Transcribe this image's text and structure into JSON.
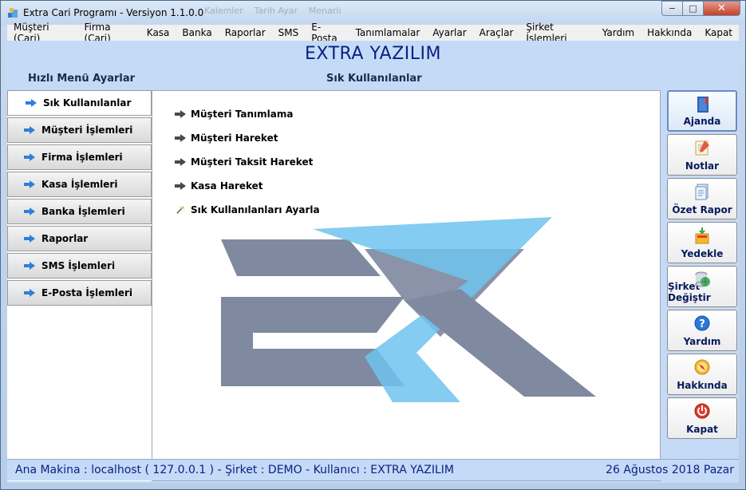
{
  "window": {
    "title": "Extra Cari Programı - Versiyon 1.1.0.0",
    "ghost_tabs": [
      "Kalemler",
      "Tarih Ayar",
      "Menarlı"
    ],
    "minimize": "−",
    "maximize": "□",
    "close": "✕"
  },
  "menu": {
    "items": [
      "Müşteri (Cari)",
      "Firma (Cari)",
      "Kasa",
      "Banka",
      "Raporlar",
      "SMS",
      "E-Posta",
      "Tanımlamalar",
      "Ayarlar",
      "Araçlar",
      "Şirket İşlemleri",
      "Yardım",
      "Hakkında",
      "Kapat"
    ]
  },
  "brand": "EXTRA YAZILIM",
  "sidebar": {
    "title": "Hızlı Menü Ayarlar",
    "items": [
      "Sık Kullanılanlar",
      "Müşteri İşlemleri",
      "Firma İşlemleri",
      "Kasa İşlemleri",
      "Banka İşlemleri",
      "Raporlar",
      "SMS İşlemleri",
      "E-Posta İşlemleri"
    ],
    "active_index": 0
  },
  "content": {
    "title": "Sık Kullanılanlar",
    "links": [
      "Müşteri Tanımlama",
      "Müşteri Hareket",
      "Müşteri Taksit Hareket",
      "Kasa Hareket"
    ],
    "settings_link": "Sık Kullanılanları Ayarla"
  },
  "right_buttons": [
    {
      "label": "Ajanda",
      "icon": "agenda-book-icon"
    },
    {
      "label": "Notlar",
      "icon": "notes-icon"
    },
    {
      "label": "Özet Rapor",
      "icon": "summary-report-icon"
    },
    {
      "label": "Yedekle",
      "icon": "backup-icon"
    },
    {
      "label": "Şirket Değiştir",
      "icon": "database-globe-icon"
    },
    {
      "label": "Yardım",
      "icon": "help-icon"
    },
    {
      "label": "Hakkında",
      "icon": "about-compass-icon"
    },
    {
      "label": "Kapat",
      "icon": "power-icon"
    }
  ],
  "status": {
    "connection": "Ana Makina : localhost ( 127.0.0.1 ) - Şirket : DEMO  -  Kullanıcı : EXTRA YAZILIM",
    "date": "26 Ağustos 2018 Pazar"
  },
  "colors": {
    "brand_text": "#0a1f82",
    "panel_bg": "#c5daf7",
    "logo_gray": "#7f8aa0",
    "logo_blue": "#6ec3ef"
  }
}
